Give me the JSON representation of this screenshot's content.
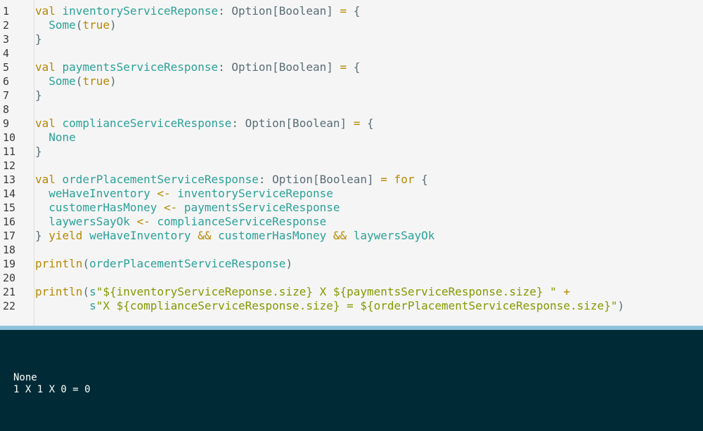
{
  "editor": {
    "line_numbers": [
      "1",
      "2",
      "3",
      "4",
      "5",
      "6",
      "7",
      "8",
      "9",
      "10",
      "11",
      "12",
      "13",
      "14",
      "15",
      "16",
      "17",
      "18",
      "19",
      "20",
      "21",
      "22"
    ],
    "lines": [
      [
        {
          "t": "kw",
          "s": "val "
        },
        {
          "t": "id",
          "s": "inventoryServiceReponse"
        },
        {
          "t": "pl",
          "s": ": "
        },
        {
          "t": "ty",
          "s": "Option[Boolean]"
        },
        {
          "t": "kw",
          "s": " = "
        },
        {
          "t": "pl",
          "s": "{"
        }
      ],
      [
        {
          "t": "pl",
          "s": "  "
        },
        {
          "t": "id",
          "s": "Some"
        },
        {
          "t": "pl",
          "s": "("
        },
        {
          "t": "kw",
          "s": "true"
        },
        {
          "t": "pl",
          "s": ")"
        }
      ],
      [
        {
          "t": "pl",
          "s": "}"
        }
      ],
      [],
      [
        {
          "t": "kw",
          "s": "val "
        },
        {
          "t": "id",
          "s": "paymentsServiceResponse"
        },
        {
          "t": "pl",
          "s": ": "
        },
        {
          "t": "ty",
          "s": "Option[Boolean]"
        },
        {
          "t": "kw",
          "s": " = "
        },
        {
          "t": "pl",
          "s": "{"
        }
      ],
      [
        {
          "t": "pl",
          "s": "  "
        },
        {
          "t": "id",
          "s": "Some"
        },
        {
          "t": "pl",
          "s": "("
        },
        {
          "t": "kw",
          "s": "true"
        },
        {
          "t": "pl",
          "s": ")"
        }
      ],
      [
        {
          "t": "pl",
          "s": "}"
        }
      ],
      [],
      [
        {
          "t": "kw",
          "s": "val "
        },
        {
          "t": "id",
          "s": "complianceServiceResponse"
        },
        {
          "t": "pl",
          "s": ": "
        },
        {
          "t": "ty",
          "s": "Option[Boolean]"
        },
        {
          "t": "kw",
          "s": " = "
        },
        {
          "t": "pl",
          "s": "{"
        }
      ],
      [
        {
          "t": "pl",
          "s": "  "
        },
        {
          "t": "id",
          "s": "None"
        }
      ],
      [
        {
          "t": "pl",
          "s": "}"
        }
      ],
      [],
      [
        {
          "t": "kw",
          "s": "val "
        },
        {
          "t": "id",
          "s": "orderPlacementServiceResponse"
        },
        {
          "t": "pl",
          "s": ": "
        },
        {
          "t": "ty",
          "s": "Option[Boolean]"
        },
        {
          "t": "kw",
          "s": " = for "
        },
        {
          "t": "pl",
          "s": "{"
        }
      ],
      [
        {
          "t": "pl",
          "s": "  "
        },
        {
          "t": "id",
          "s": "weHaveInventory"
        },
        {
          "t": "kw",
          "s": " <- "
        },
        {
          "t": "id",
          "s": "inventoryServiceReponse"
        }
      ],
      [
        {
          "t": "pl",
          "s": "  "
        },
        {
          "t": "id",
          "s": "customerHasMoney"
        },
        {
          "t": "kw",
          "s": " <- "
        },
        {
          "t": "id",
          "s": "paymentsServiceResponse"
        }
      ],
      [
        {
          "t": "pl",
          "s": "  "
        },
        {
          "t": "id",
          "s": "laywersSayOk"
        },
        {
          "t": "kw",
          "s": " <- "
        },
        {
          "t": "id",
          "s": "complianceServiceResponse"
        }
      ],
      [
        {
          "t": "pl",
          "s": "} "
        },
        {
          "t": "kw",
          "s": "yield "
        },
        {
          "t": "id",
          "s": "weHaveInventory"
        },
        {
          "t": "kw",
          "s": " && "
        },
        {
          "t": "id",
          "s": "customerHasMoney"
        },
        {
          "t": "kw",
          "s": " && "
        },
        {
          "t": "id",
          "s": "laywersSayOk"
        }
      ],
      [],
      [
        {
          "t": "kw",
          "s": "println"
        },
        {
          "t": "pl",
          "s": "("
        },
        {
          "t": "id",
          "s": "orderPlacementServiceResponse"
        },
        {
          "t": "pl",
          "s": ")"
        }
      ],
      [],
      [
        {
          "t": "kw",
          "s": "println"
        },
        {
          "t": "pl",
          "s": "("
        },
        {
          "t": "id",
          "s": "s"
        },
        {
          "t": "str",
          "s": "\"${inventoryServiceReponse.size} X ${paymentsServiceResponse.size} \""
        },
        {
          "t": "kw",
          "s": " +"
        }
      ],
      [
        {
          "t": "pl",
          "s": "        "
        },
        {
          "t": "id",
          "s": "s"
        },
        {
          "t": "str",
          "s": "\"X ${complianceServiceResponse.size} = ${orderPlacementServiceResponse.size}\""
        },
        {
          "t": "pl",
          "s": ")"
        }
      ]
    ]
  },
  "console": {
    "output": [
      "None",
      "1 X 1 X 0 = 0"
    ]
  }
}
